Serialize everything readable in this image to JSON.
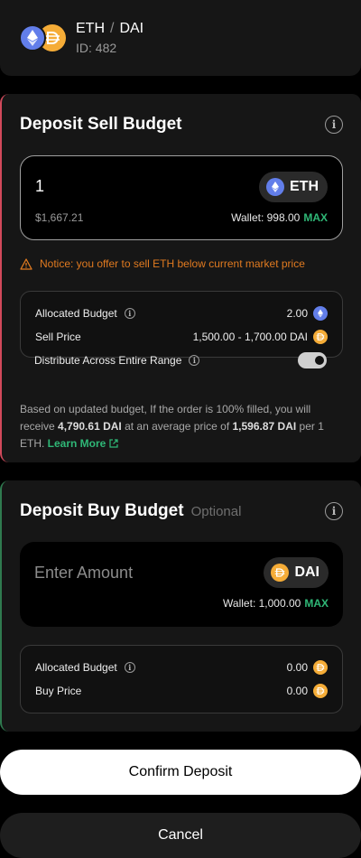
{
  "pair": {
    "base": "ETH",
    "separator": "/",
    "quote": "DAI",
    "id_label": "ID: 482"
  },
  "sell_budget": {
    "title": "Deposit Sell Budget",
    "amount": "1",
    "token": "ETH",
    "usd_value": "$1,667.21",
    "wallet_label": "Wallet: 998.00",
    "max_label": "MAX",
    "notice": "Notice: you offer to sell ETH below current market price",
    "summary": {
      "allocated_label": "Allocated Budget",
      "allocated_value": "2.00",
      "price_label": "Sell Price",
      "price_value": "1,500.00 - 1,700.00 DAI",
      "distribute_label": "Distribute Across Entire Range",
      "distribute_on": true
    },
    "desc": {
      "part1": "Based on updated budget, If the order is 100% filled, you will receive ",
      "amount": "4,790.61 DAI",
      "part2": " at an average price of ",
      "price": "1,596.87 DAI",
      "part3": " per 1 ETH. ",
      "learn_more": "Learn More"
    }
  },
  "buy_budget": {
    "title": "Deposit Buy Budget",
    "optional_label": "Optional",
    "placeholder": "Enter Amount",
    "token": "DAI",
    "wallet_label": "Wallet: 1,000.00",
    "max_label": "MAX",
    "summary": {
      "allocated_label": "Allocated Budget",
      "allocated_value": "0.00",
      "price_label": "Buy Price",
      "price_value": "0.00"
    }
  },
  "actions": {
    "confirm_label": "Confirm Deposit",
    "cancel_label": "Cancel"
  },
  "colors": {
    "eth": "#627EEA",
    "dai": "#F5AC37",
    "accent_green": "#2fb877",
    "sell_border": "#d1495b",
    "buy_border": "#2f7a4f",
    "notice": "#e07a20"
  }
}
